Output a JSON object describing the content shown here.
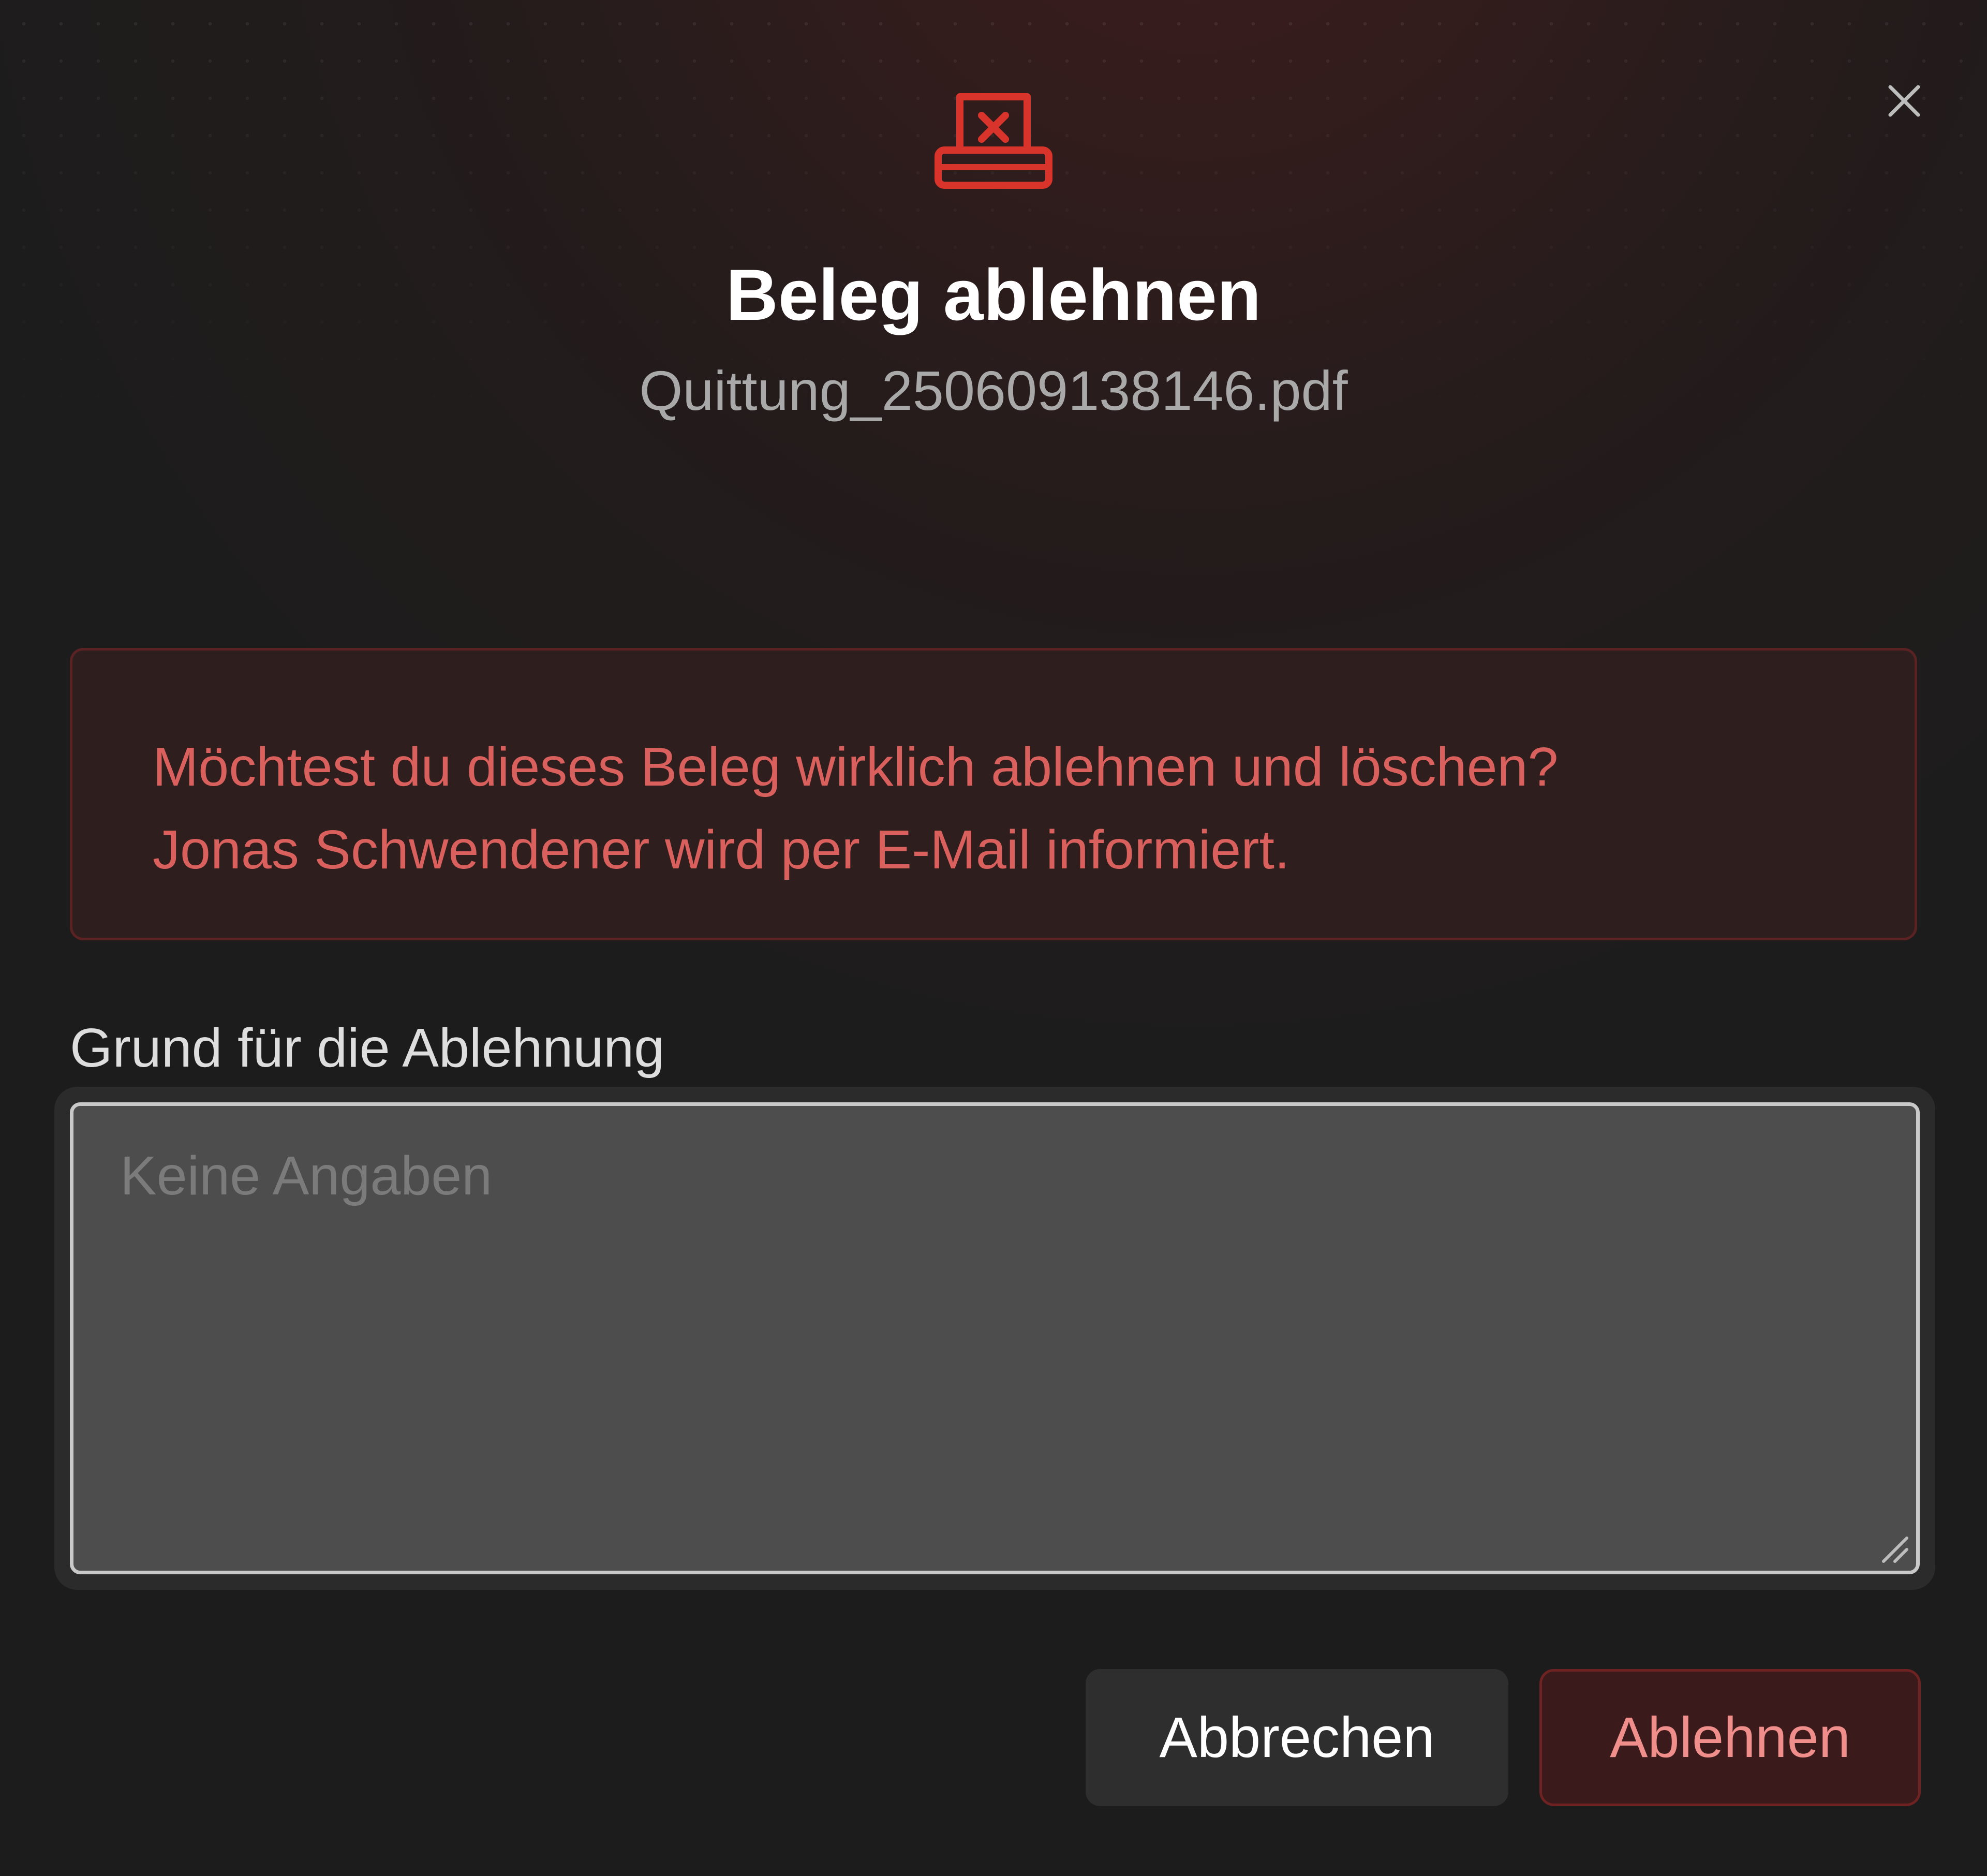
{
  "dialog": {
    "title": "Beleg ablehnen",
    "filename": "Quittung_250609138146.pdf",
    "header_icon": "receipt-reject-icon",
    "close_icon": "close-icon",
    "warning": {
      "line1": "Möchtest du dieses Beleg wirklich ablehnen und löschen?",
      "line2": "Jonas Schwendener wird per E-Mail informiert."
    },
    "reason": {
      "label": "Grund für die Ablehnung",
      "placeholder": "Keine Angaben",
      "value": ""
    },
    "buttons": {
      "cancel_label": "Abbrechen",
      "reject_label": "Ablehnen"
    }
  },
  "colors": {
    "accent_red": "#d9342b",
    "warning_text": "#d9605c",
    "warning_bg": "#2e1e1e",
    "background": "#1c1c1c",
    "reject_text": "#ef8e8a"
  }
}
